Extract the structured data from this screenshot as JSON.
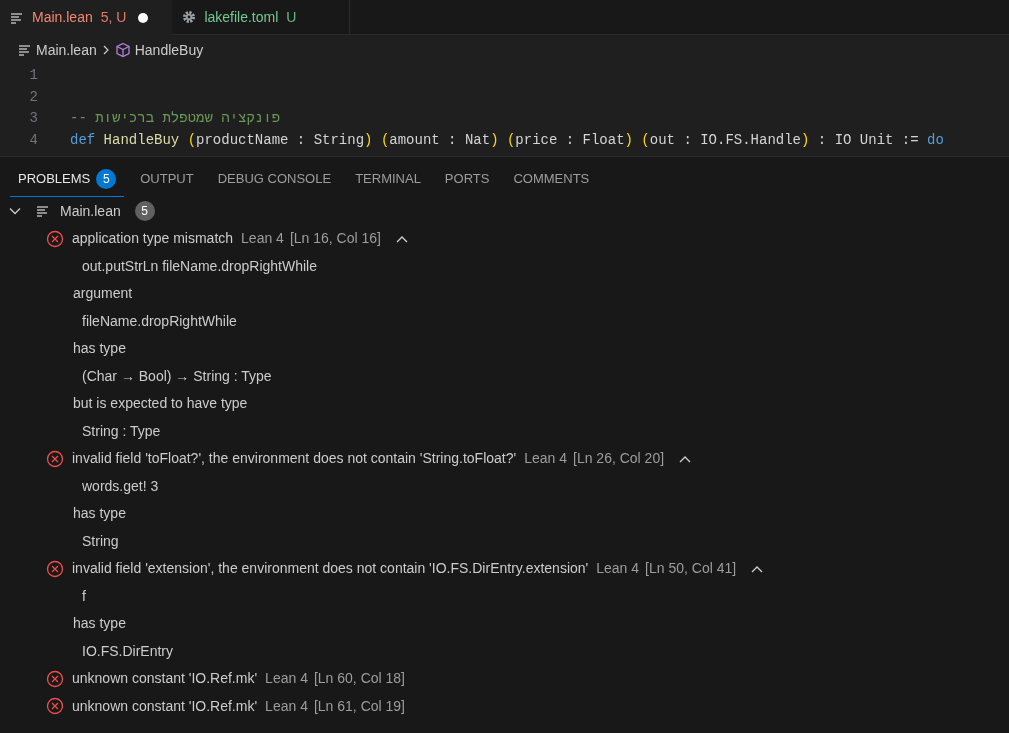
{
  "tabs": [
    {
      "name": "Main.lean",
      "badge": "5, U",
      "kind": "error",
      "dirty": true,
      "selected": true
    },
    {
      "name": "lakefile.toml",
      "badge": "U",
      "kind": "untracked",
      "dirty": false,
      "selected": false
    }
  ],
  "breadcrumbs": [
    {
      "label": "Main.lean"
    },
    {
      "label": "HandleBuy"
    }
  ],
  "code_lines": [
    {
      "number": "1"
    },
    {
      "number": "2"
    },
    {
      "number": "3",
      "tokens": [
        {
          "kind": "comment",
          "text": "-- פונקציה שמטפלת ברכישות"
        }
      ]
    },
    {
      "number": "4",
      "tokens": [
        {
          "kind": "keyword",
          "text": "def"
        },
        {
          "kind": "function",
          "text": " HandleBuy"
        },
        {
          "kind": "bracket",
          "text": " ("
        },
        {
          "kind": "plain",
          "text": "productName : String"
        },
        {
          "kind": "bracket",
          "text": ")"
        },
        {
          "kind": "bracket",
          "text": " ("
        },
        {
          "kind": "plain",
          "text": "amount : Nat"
        },
        {
          "kind": "bracket",
          "text": ")"
        },
        {
          "kind": "bracket",
          "text": " ("
        },
        {
          "kind": "plain",
          "text": "price : Float"
        },
        {
          "kind": "bracket",
          "text": ")"
        },
        {
          "kind": "bracket",
          "text": " ("
        },
        {
          "kind": "plain",
          "text": "out : IO.FS.Handle"
        },
        {
          "kind": "bracket",
          "text": ")"
        },
        {
          "kind": "plain",
          "text": " : IO Unit := "
        },
        {
          "kind": "keyword",
          "text": "do"
        }
      ]
    }
  ],
  "panel_tabs": [
    {
      "label": "PROBLEMS",
      "count": "5",
      "selected": true
    },
    {
      "label": "OUTPUT",
      "selected": false
    },
    {
      "label": "DEBUG CONSOLE",
      "selected": false
    },
    {
      "label": "TERMINAL",
      "selected": false
    },
    {
      "label": "PORTS",
      "selected": false
    },
    {
      "label": "COMMENTS",
      "selected": false
    }
  ],
  "problems": {
    "file": "Main.lean",
    "count": "5",
    "expanded": true,
    "items": [
      {
        "message": "application type mismatch",
        "source": "Lean 4",
        "location": "[Ln 16, Col 16]",
        "expanded": true,
        "details": [
          {
            "kind": "code",
            "text": "out.putStrLn fileName.dropRightWhile"
          },
          {
            "kind": "label",
            "text": "argument"
          },
          {
            "kind": "code",
            "text": "fileName.dropRightWhile"
          },
          {
            "kind": "label",
            "text": "has type"
          },
          {
            "kind": "code",
            "text": "(Char → Bool) → String : Type"
          },
          {
            "kind": "label",
            "text": "but is expected to have type"
          },
          {
            "kind": "code",
            "text": "String : Type"
          }
        ]
      },
      {
        "message": "invalid field 'toFloat?', the environment does not contain 'String.toFloat?'",
        "source": "Lean 4",
        "location": "[Ln 26, Col 20]",
        "expanded": true,
        "details": [
          {
            "kind": "code",
            "text": "words.get! 3"
          },
          {
            "kind": "label",
            "text": "has type"
          },
          {
            "kind": "code",
            "text": "String"
          }
        ]
      },
      {
        "message": "invalid field 'extension', the environment does not contain 'IO.FS.DirEntry.extension'",
        "source": "Lean 4",
        "location": "[Ln 50, Col 41]",
        "expanded": true,
        "details": [
          {
            "kind": "code",
            "text": "f"
          },
          {
            "kind": "label",
            "text": "has type"
          },
          {
            "kind": "code",
            "text": "IO.FS.DirEntry"
          }
        ]
      },
      {
        "message": "unknown constant 'IO.Ref.mk'",
        "source": "Lean 4",
        "location": "[Ln 60, Col 18]",
        "expanded": false
      },
      {
        "message": "unknown constant 'IO.Ref.mk'",
        "source": "Lean 4",
        "location": "[Ln 61, Col 19]",
        "expanded": false
      }
    ]
  }
}
